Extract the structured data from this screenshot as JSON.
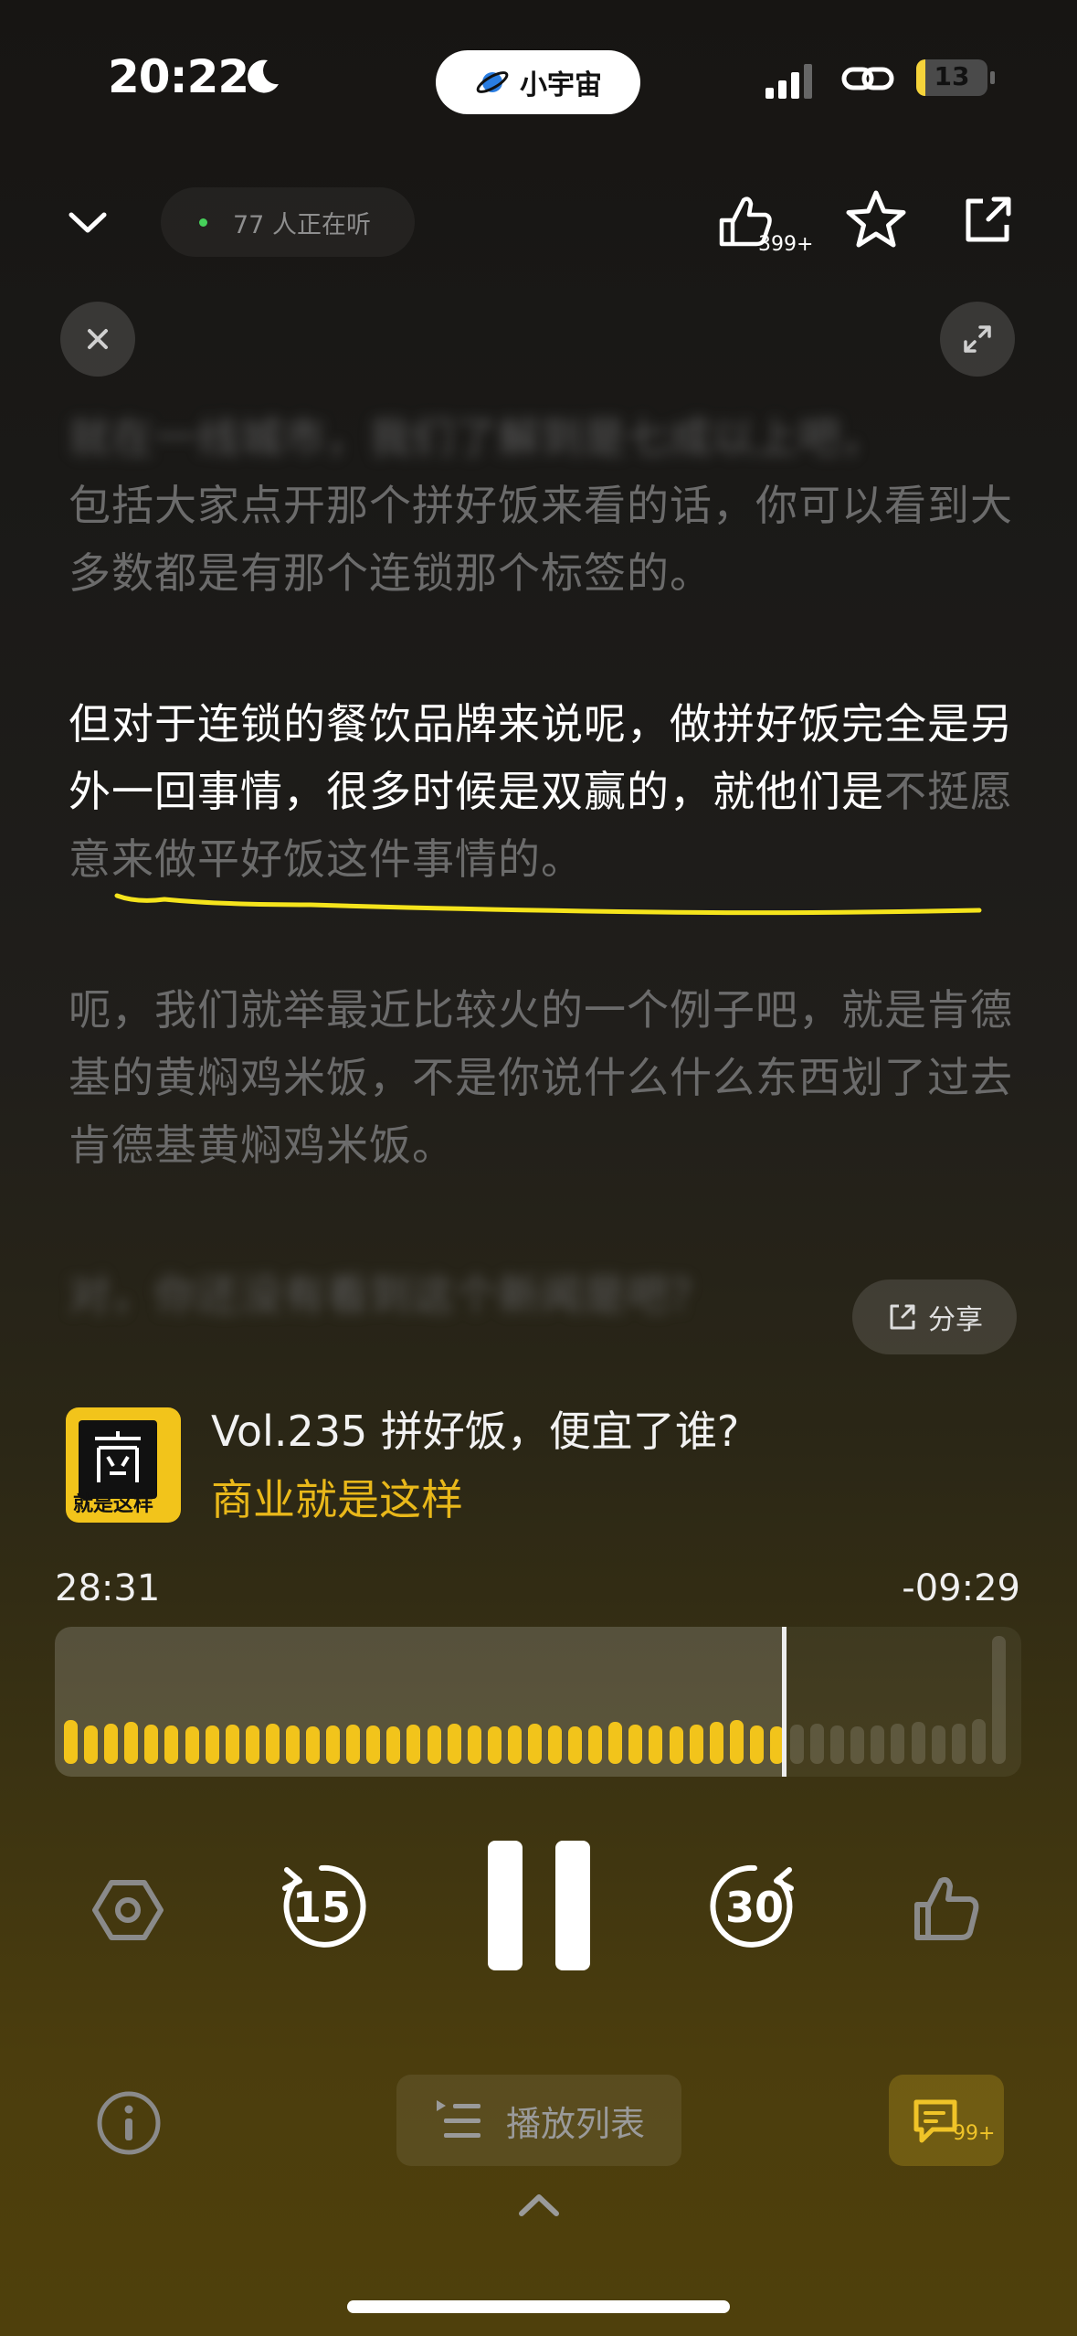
{
  "status_bar": {
    "time": "20:22",
    "app_pill": "小宇宙",
    "battery": "13",
    "battery_level": 0.13
  },
  "top_bar": {
    "listeners": "77 人正在听",
    "like_count": "399+"
  },
  "transcript": {
    "blurred_top": "就在一线城市，我们了解到是七成以上吧，",
    "para1": "包括大家点开那个拼好饭来看的话，你可以看到大多数都是有那个连锁那个标签的。",
    "current_spoken": "但对于连锁的餐饮品牌来说呢，做拼好饭完全是另外一回事情，很多时候是双赢的，就他们是",
    "current_unspoken": "不挺愿意来做平好饭这件事情的。",
    "para3": "呃，我们就举最近比较火的一个例子吧，就是肯德基的黄焖鸡米饭，不是你说什么什么东西划了过去肯德基黄焖鸡米饭。",
    "blurred_bottom": "对，你还没有看到这个新闻是吧？",
    "share_label": "分享"
  },
  "episode": {
    "title": "Vol.235 拼好饭，便宜了谁?",
    "show": "商业就是这样",
    "cover_text": "商业 就是这样"
  },
  "progress": {
    "elapsed": "28:31",
    "remaining": "-09:29",
    "fraction": 0.754,
    "levels": [
      0.6,
      0.45,
      0.5,
      0.55,
      0.48,
      0.45,
      0.42,
      0.45,
      0.48,
      0.45,
      0.5,
      0.45,
      0.42,
      0.45,
      0.48,
      0.45,
      0.42,
      0.48,
      0.45,
      0.5,
      0.45,
      0.42,
      0.45,
      0.5,
      0.45,
      0.42,
      0.45,
      0.55,
      0.48,
      0.45,
      0.42,
      0.48,
      0.55,
      0.6,
      0.45,
      0.42,
      0.48,
      0.5,
      0.45,
      0.42,
      0.45,
      0.5,
      0.55,
      0.45,
      0.5,
      0.65,
      1.0
    ]
  },
  "controls": {
    "skip_back": "15",
    "skip_forward": "30",
    "playlist_label": "播放列表",
    "comment_count": "99+"
  },
  "colors": {
    "accent": "#f2c41b",
    "highlight_line": "#f5e41c",
    "show_title": "#e9b81a"
  }
}
